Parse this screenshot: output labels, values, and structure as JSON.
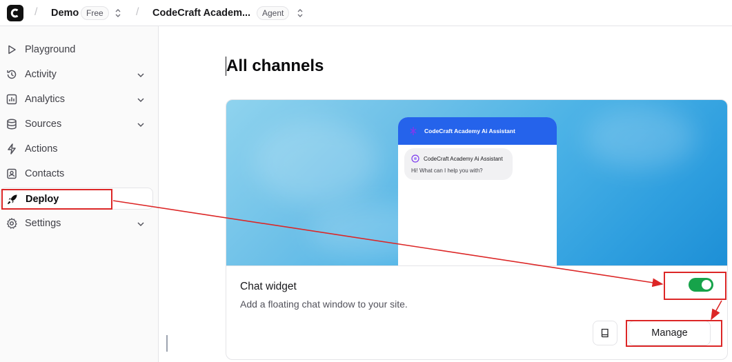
{
  "topbar": {
    "workspace": "Demo",
    "workspace_plan": "Free",
    "agent_name": "CodeCraft Academ...",
    "agent_badge": "Agent"
  },
  "sidebar": {
    "items": [
      {
        "label": "Playground",
        "icon": "play-icon",
        "has_chevron": false
      },
      {
        "label": "Activity",
        "icon": "history-icon",
        "has_chevron": true
      },
      {
        "label": "Analytics",
        "icon": "chart-icon",
        "has_chevron": true
      },
      {
        "label": "Sources",
        "icon": "database-icon",
        "has_chevron": true
      },
      {
        "label": "Actions",
        "icon": "bolt-icon",
        "has_chevron": false
      },
      {
        "label": "Contacts",
        "icon": "contact-icon",
        "has_chevron": false
      },
      {
        "label": "Deploy",
        "icon": "rocket-icon",
        "has_chevron": false,
        "active": true
      },
      {
        "label": "Settings",
        "icon": "gear-icon",
        "has_chevron": true
      }
    ]
  },
  "main": {
    "title": "All channels",
    "card": {
      "preview": {
        "header_title": "CodeCraft Academy Ai Assistant",
        "bot_name": "CodeCraft Academy Ai Assistant",
        "greeting": "Hi! What can I help you with?"
      },
      "title": "Chat widget",
      "description": "Add a floating chat window to your site.",
      "toggle_on": true,
      "manage_label": "Manage"
    }
  },
  "colors": {
    "toggle": "#16a34a",
    "widget_header": "#2563eb",
    "annotation": "#dc2626"
  }
}
